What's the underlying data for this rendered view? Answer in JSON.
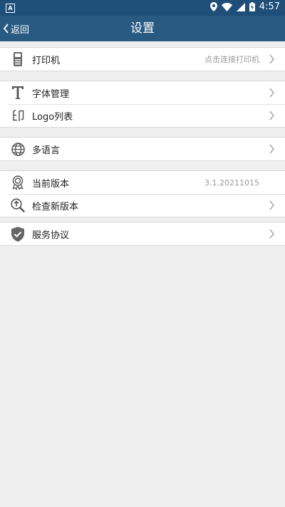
{
  "status_bar": {
    "app_badge": "A",
    "time": "4:57"
  },
  "nav": {
    "back_label": "返回",
    "title": "设置"
  },
  "groups": [
    {
      "items": [
        {
          "label": "打印机",
          "value": "点击连接打印机"
        }
      ]
    },
    {
      "items": [
        {
          "label": "字体管理"
        },
        {
          "label": "Logo列表"
        }
      ]
    },
    {
      "items": [
        {
          "label": "多语言"
        }
      ]
    },
    {
      "items": [
        {
          "label": "当前版本",
          "value": "3.1.20211015"
        },
        {
          "label": "检查新版本"
        }
      ]
    },
    {
      "items": [
        {
          "label": "服务协议"
        }
      ]
    }
  ],
  "colors": {
    "status_bar": "#1f4e79",
    "title_bar": "#295a82",
    "background": "#efefef"
  }
}
